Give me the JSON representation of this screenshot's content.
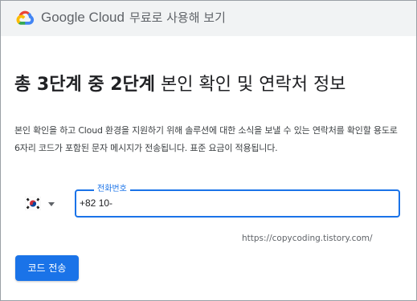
{
  "header": {
    "brand_name": "Google Cloud",
    "brand_sub": "무료로 사용해 보기",
    "logo_icon": "google-cloud-logo"
  },
  "main": {
    "title_step": "총 3단계 중 2단계",
    "title_rest": "본인 확인 및 연락처 정보",
    "description": "본인 확인을 하고 Cloud 환경을 지원하기 위해 솔루션에 대한 소식을 보낼 수 있는 연락처를 확인할 용도로 6자리 코드가 포함된 문자 메시지가 전송됩니다. 표준 요금이 적용됩니다.",
    "country": {
      "flag_icon": "south-korea-flag-icon",
      "dropdown_icon": "caret-down-icon"
    },
    "phone": {
      "label": "전화번호",
      "value": "+82 10-"
    },
    "watermark": "https://copycoding.tistory.com/",
    "send_button": "코드 전송"
  },
  "colors": {
    "accent": "#1a73e8",
    "header_bg": "#f1f3f4",
    "text": "#202124",
    "muted": "#5f6368"
  }
}
